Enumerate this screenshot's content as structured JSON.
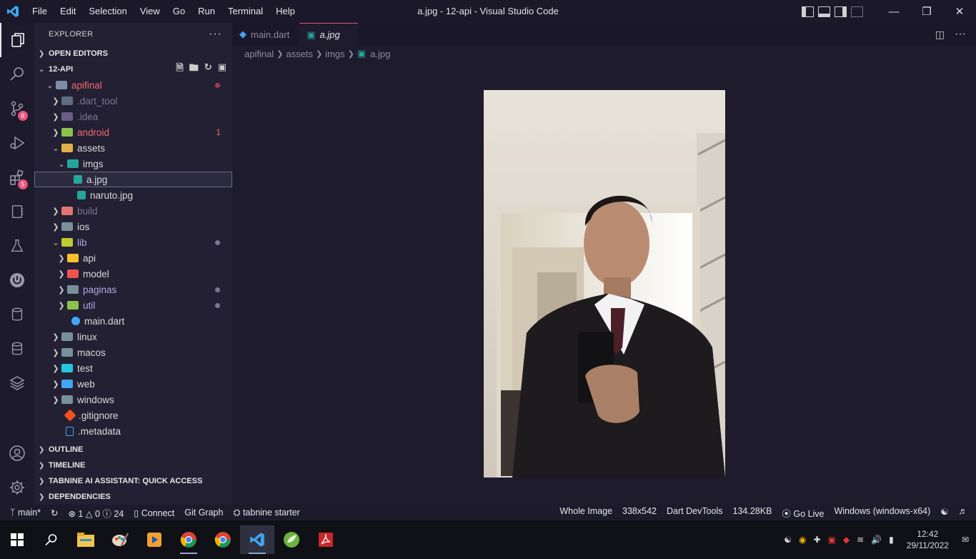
{
  "titlebar": {
    "menu": [
      "File",
      "Edit",
      "Selection",
      "View",
      "Go",
      "Run",
      "Terminal",
      "Help"
    ],
    "title": "a.jpg - 12-api - Visual Studio Code"
  },
  "activity_bar": {
    "scm_badge": "6",
    "extensions_badge": "5"
  },
  "sidebar": {
    "header": "EXPLORER",
    "open_editors": "OPEN EDITORS",
    "project": "12-API",
    "tree": [
      {
        "label": "apifinal",
        "status": "red"
      },
      {
        "label": ".dart_tool"
      },
      {
        "label": ".idea"
      },
      {
        "label": "android",
        "count": "1"
      },
      {
        "label": "assets"
      },
      {
        "label": "imgs"
      },
      {
        "label": "a.jpg"
      },
      {
        "label": "naruto.jpg"
      },
      {
        "label": "build"
      },
      {
        "label": "ios"
      },
      {
        "label": "lib"
      },
      {
        "label": "api"
      },
      {
        "label": "model"
      },
      {
        "label": "paginas"
      },
      {
        "label": "util"
      },
      {
        "label": "main.dart"
      },
      {
        "label": "linux"
      },
      {
        "label": "macos"
      },
      {
        "label": "test"
      },
      {
        "label": "web"
      },
      {
        "label": "windows"
      },
      {
        "label": ".gitignore"
      },
      {
        "label": ".metadata"
      }
    ],
    "sections": [
      "OUTLINE",
      "TIMELINE",
      "TABNINE AI ASSISTANT: QUICK ACCESS",
      "DEPENDENCIES"
    ]
  },
  "editor": {
    "tabs": [
      "main.dart",
      "a.jpg"
    ],
    "breadcrumb": [
      "apifinal",
      "assets",
      "imgs",
      "a.jpg"
    ]
  },
  "statusbar": {
    "branch": "main*",
    "errors": "1",
    "warnings": "0",
    "infos": "24",
    "connect": "Connect",
    "git_graph": "Git Graph",
    "tabnine": "tabnine starter",
    "whole_image": "Whole Image",
    "dimensions": "338x542",
    "devtools": "Dart DevTools",
    "size": "134.28KB",
    "golive": "Go Live",
    "platform": "Windows (windows-x64)"
  },
  "taskbar": {
    "time": "12:42",
    "date": "29/11/2022"
  }
}
